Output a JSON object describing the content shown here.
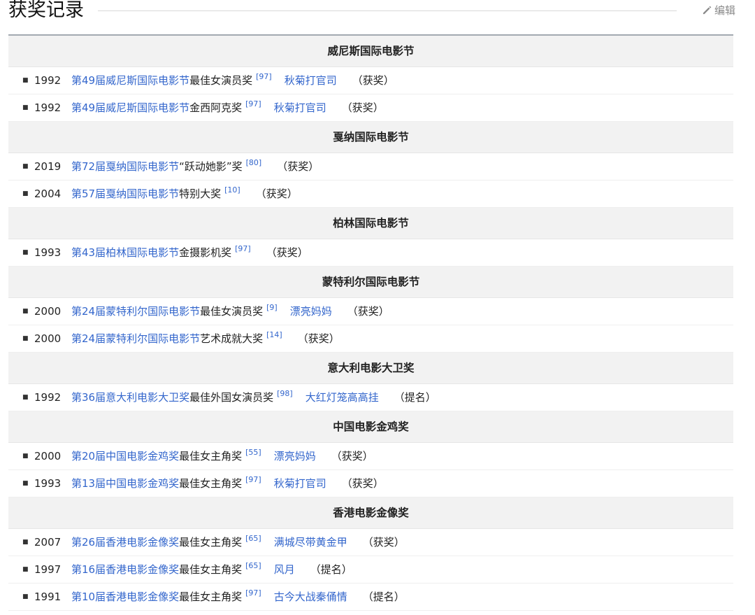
{
  "heading": {
    "title": "获奖记录",
    "edit_label": "编辑"
  },
  "sections": [
    {
      "title": "威尼斯国际电影节",
      "rows": [
        {
          "year": "1992",
          "event": "第49届威尼斯国际电影节",
          "award": "最佳女演员奖",
          "ref": "[97]",
          "film": "秋菊打官司",
          "result": "（获奖）"
        },
        {
          "year": "1992",
          "event": "第49届威尼斯国际电影节",
          "award": "金西阿克奖",
          "ref": "[97]",
          "film": "秋菊打官司",
          "result": "（获奖）"
        }
      ]
    },
    {
      "title": "戛纳国际电影节",
      "rows": [
        {
          "year": "2019",
          "event": "第72届戛纳国际电影节",
          "award": "“跃动她影”奖",
          "ref": "[80]",
          "film": "",
          "result": "（获奖）"
        },
        {
          "year": "2004",
          "event": "第57届戛纳国际电影节",
          "award": "特别大奖",
          "ref": "[10]",
          "film": "",
          "result": "（获奖）"
        }
      ]
    },
    {
      "title": "柏林国际电影节",
      "rows": [
        {
          "year": "1993",
          "event": "第43届柏林国际电影节",
          "award": "金摄影机奖",
          "ref": "[97]",
          "film": "",
          "result": "（获奖）"
        }
      ]
    },
    {
      "title": "蒙特利尔国际电影节",
      "rows": [
        {
          "year": "2000",
          "event": "第24届蒙特利尔国际电影节",
          "award": "最佳女演员奖",
          "ref": "[9]",
          "film": "漂亮妈妈",
          "result": "（获奖）"
        },
        {
          "year": "2000",
          "event": "第24届蒙特利尔国际电影节",
          "award": "艺术成就大奖",
          "ref": "[14]",
          "film": "",
          "result": "（获奖）"
        }
      ]
    },
    {
      "title": "意大利电影大卫奖",
      "rows": [
        {
          "year": "1992",
          "event": "第36届意大利电影大卫奖",
          "award": "最佳外国女演员奖",
          "ref": "[98]",
          "film": "大红灯笼高高挂",
          "result": "（提名）"
        }
      ]
    },
    {
      "title": "中国电影金鸡奖",
      "rows": [
        {
          "year": "2000",
          "event": "第20届中国电影金鸡奖",
          "award": "最佳女主角奖",
          "ref": "[55]",
          "film": "漂亮妈妈",
          "result": "（获奖）"
        },
        {
          "year": "1993",
          "event": "第13届中国电影金鸡奖",
          "award": "最佳女主角奖",
          "ref": "[97]",
          "film": "秋菊打官司",
          "result": "（获奖）"
        }
      ]
    },
    {
      "title": "香港电影金像奖",
      "rows": [
        {
          "year": "2007",
          "event": "第26届香港电影金像奖",
          "award": "最佳女主角奖",
          "ref": "[65]",
          "film": "满城尽带黄金甲",
          "result": "（获奖）"
        },
        {
          "year": "1997",
          "event": "第16届香港电影金像奖",
          "award": "最佳女主角奖",
          "ref": "[65]",
          "film": "风月",
          "result": "（提名）"
        },
        {
          "year": "1991",
          "event": "第10届香港电影金像奖",
          "award": "最佳女主角奖",
          "ref": "[97]",
          "film": "古今大战秦俑情",
          "result": "（提名）"
        }
      ]
    }
  ],
  "colors": {
    "link": "#3366cc",
    "section_bg": "#f2f2f2",
    "table_top_border": "#a2a9b1"
  },
  "icons": {
    "edit": "pencil-icon"
  }
}
